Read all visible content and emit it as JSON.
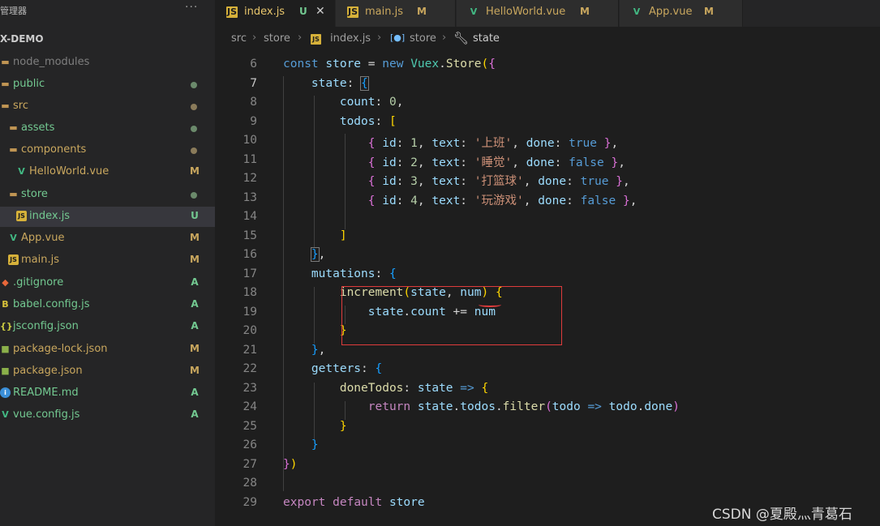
{
  "sidebar": {
    "header": "管理器",
    "more": "···",
    "project": "X-DEMO",
    "items": [
      {
        "label": "node_modules",
        "icon": "folder-icon",
        "status": ""
      },
      {
        "label": "public",
        "icon": "folder-icon",
        "status": "dot-green"
      },
      {
        "label": "src",
        "icon": "folder-icon",
        "status": "dot-brown"
      },
      {
        "label": "assets",
        "icon": "folder-icon",
        "status": "dot-green"
      },
      {
        "label": "components",
        "icon": "folder-icon",
        "status": "dot-brown"
      },
      {
        "label": "HelloWorld.vue",
        "icon": "vue-icon",
        "status": "M"
      },
      {
        "label": "store",
        "icon": "folder-icon",
        "status": "dot-green"
      },
      {
        "label": "index.js",
        "icon": "js-icon",
        "status": "U"
      },
      {
        "label": "App.vue",
        "icon": "vue-icon",
        "status": "M"
      },
      {
        "label": "main.js",
        "icon": "js-icon",
        "status": "M"
      },
      {
        "label": ".gitignore",
        "icon": "git-icon",
        "status": "A"
      },
      {
        "label": "babel.config.js",
        "icon": "babel-icon",
        "status": "A"
      },
      {
        "label": "jsconfig.json",
        "icon": "json-icon",
        "status": "A"
      },
      {
        "label": "package-lock.json",
        "icon": "npm-icon",
        "status": "M"
      },
      {
        "label": "package.json",
        "icon": "npm-icon",
        "status": "M"
      },
      {
        "label": "README.md",
        "icon": "info-icon",
        "status": "A"
      },
      {
        "label": "vue.config.js",
        "icon": "vue-config-icon",
        "status": "A"
      }
    ]
  },
  "tabs": [
    {
      "label": "index.js",
      "mark": "U",
      "close": "✕"
    },
    {
      "label": "main.js",
      "mark": "M"
    },
    {
      "label": "HelloWorld.vue",
      "mark": "M"
    },
    {
      "label": "App.vue",
      "mark": "M"
    }
  ],
  "breadcrumb": {
    "src": "src",
    "store": "store",
    "file": "index.js",
    "symbol": "store",
    "leaf": "state"
  },
  "code": {
    "line_numbers": [
      "6",
      "7",
      "8",
      "9",
      "10",
      "11",
      "12",
      "13",
      "14",
      "15",
      "16",
      "17",
      "18",
      "19",
      "20",
      "21",
      "22",
      "23",
      "24",
      "25",
      "26",
      "27",
      "28",
      "29"
    ],
    "current_line": "7",
    "t_const": "const",
    "t_store": "store",
    "t_eq": " = ",
    "t_new": "new",
    "t_vuex": "Vuex",
    "t_dot": ".",
    "t_Store": "Store",
    "t_state": "state",
    "t_colon": ": ",
    "t_count": "count",
    "t_zero": "0",
    "t_comma": ",",
    "t_todos": "todos",
    "t_id": "id",
    "t_text": "text",
    "t_done": "done",
    "n1": "1",
    "n2": "2",
    "n3": "3",
    "n4": "4",
    "s1": "'上班'",
    "s2": "'睡觉'",
    "s3": "'打篮球'",
    "s4": "'玩游戏'",
    "t_true": "true",
    "t_false": "false",
    "t_mutations": "mutations",
    "t_increment": "increment",
    "t_num": "num",
    "t_pluseq": " += ",
    "t_getters": "getters",
    "t_doneTodos": "doneTodos",
    "t_arrow": "=>",
    "t_return": "return",
    "t_todosf": "todos",
    "t_filter": "filter",
    "t_todo": "todo",
    "t_export": "export",
    "t_default": "default"
  },
  "watermark": "CSDN @夏殿灬青葛石"
}
